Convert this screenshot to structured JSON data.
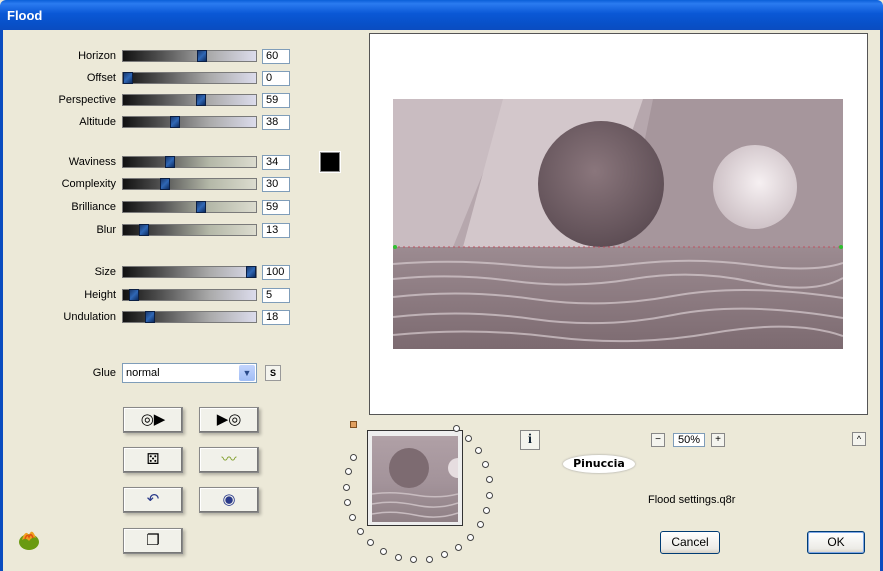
{
  "window": {
    "title": "Flood"
  },
  "sliders_group1": [
    {
      "name": "horizon",
      "label": "Horizon",
      "value": "60",
      "level": 0.6
    },
    {
      "name": "offset",
      "label": "Offset",
      "value": "0",
      "level": 0.0
    },
    {
      "name": "perspective",
      "label": "Perspective",
      "value": "59",
      "level": 0.59
    },
    {
      "name": "altitude",
      "label": "Altitude",
      "value": "38",
      "level": 0.38
    }
  ],
  "sliders_group2": [
    {
      "name": "waviness",
      "label": "Waviness",
      "value": "34",
      "level": 0.34
    },
    {
      "name": "complexity",
      "label": "Complexity",
      "value": "30",
      "level": 0.3
    },
    {
      "name": "brilliance",
      "label": "Brilliance",
      "value": "59",
      "level": 0.59
    },
    {
      "name": "blur",
      "label": "Blur",
      "value": "13",
      "level": 0.13
    }
  ],
  "sliders_group3": [
    {
      "name": "size",
      "label": "Size",
      "value": "100",
      "level": 1.0
    },
    {
      "name": "height",
      "label": "Height",
      "value": "5",
      "level": 0.05
    },
    {
      "name": "undulation",
      "label": "Undulation",
      "value": "18",
      "level": 0.18
    }
  ],
  "color_swatch": "#000000",
  "glue": {
    "label": "Glue",
    "value": "normal",
    "s_button": "S"
  },
  "zoom": {
    "value": "50%",
    "minus": "−",
    "plus": "+"
  },
  "info_button": "i",
  "logo_text": "Pinuccia",
  "settings_file": "Flood settings.q8r",
  "buttons": {
    "cancel": "Cancel",
    "ok": "OK"
  },
  "up_button": "^"
}
